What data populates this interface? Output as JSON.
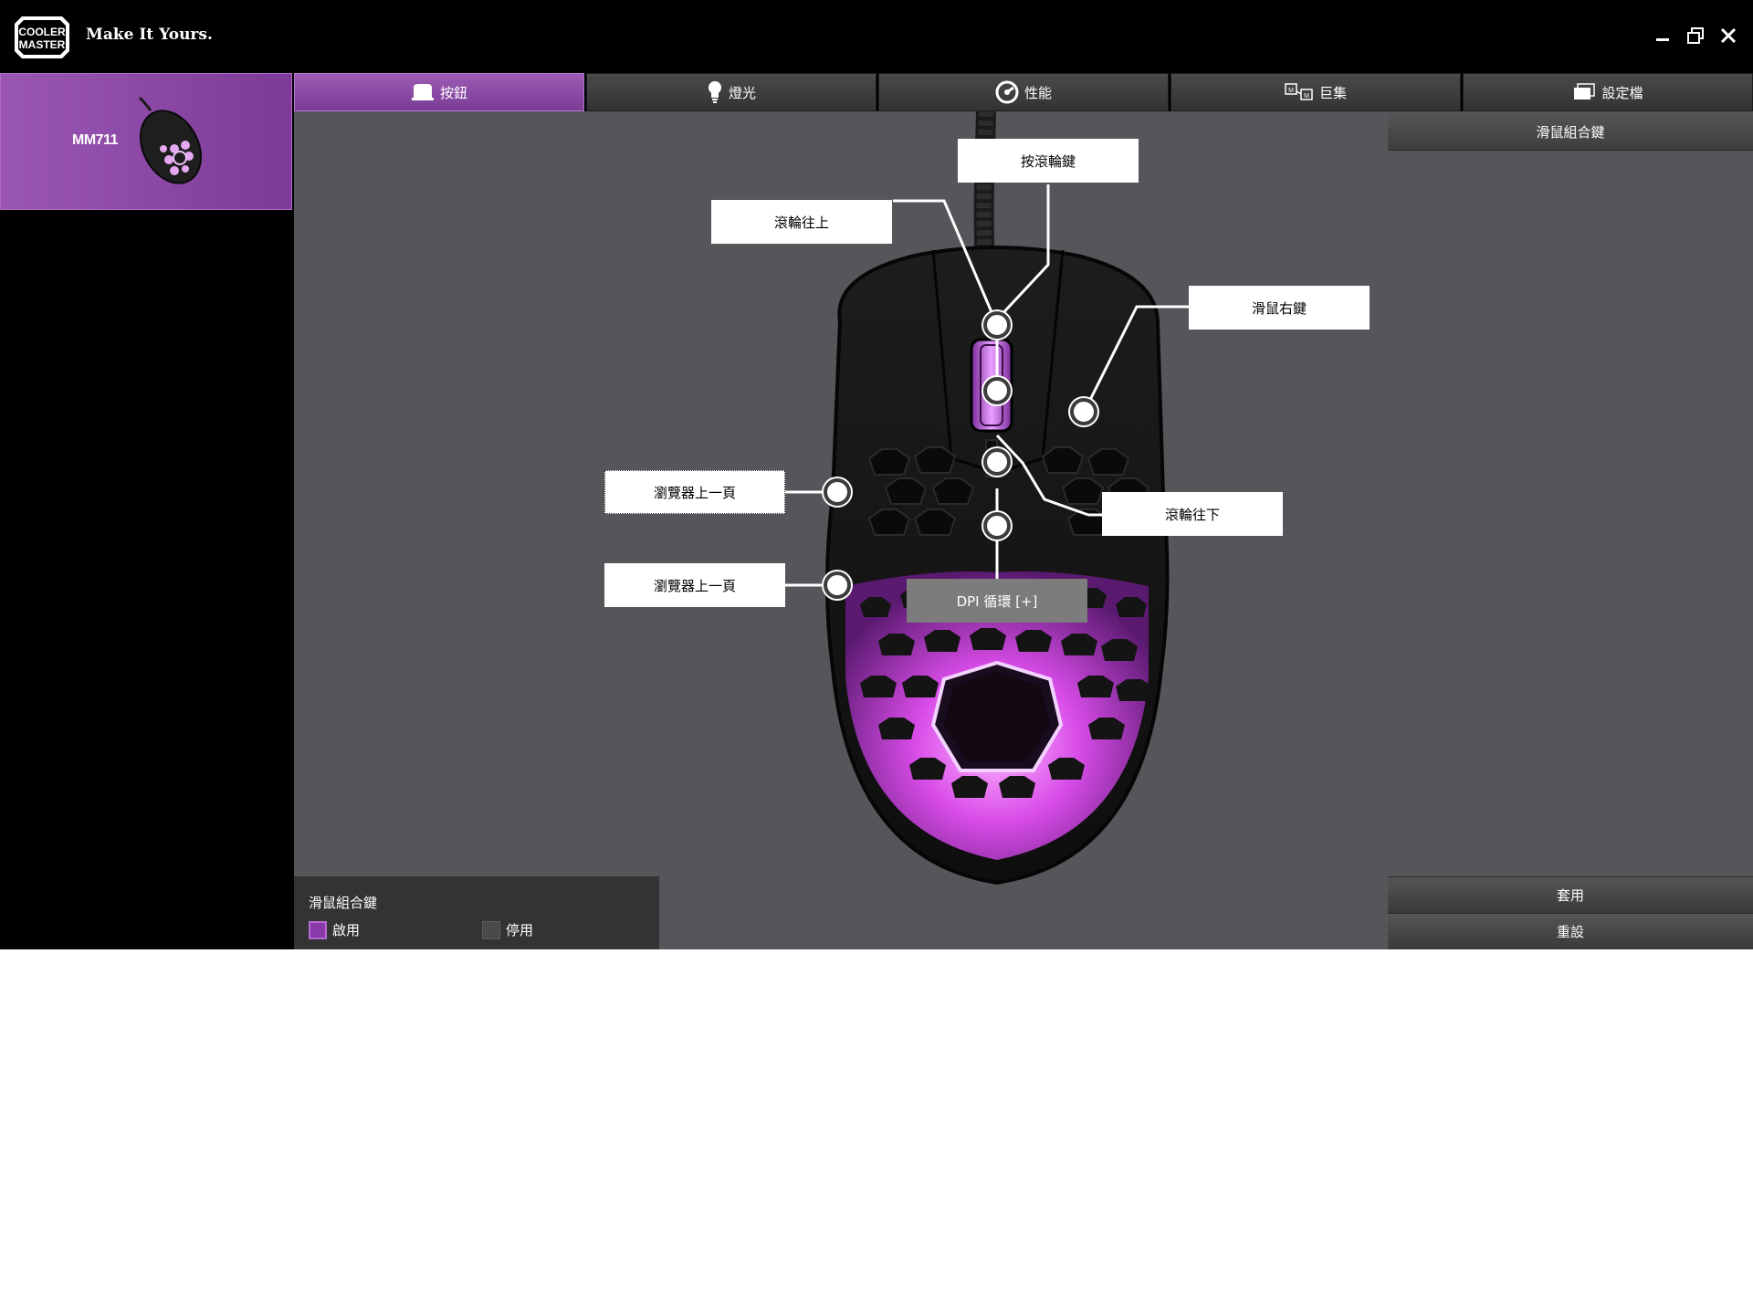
{
  "titlebar": {
    "logo_text": "COOLER MASTER",
    "slogan": "Make It Yours.",
    "window_controls": [
      "minimize-icon",
      "restore-icon",
      "close-icon"
    ]
  },
  "sidebar": {
    "device_name": "MM711"
  },
  "tabs": [
    {
      "label": "按鈕",
      "icon": "mouse-button-icon",
      "active": true
    },
    {
      "label": "燈光",
      "icon": "lightbulb-icon",
      "active": false
    },
    {
      "label": "性能",
      "icon": "performance-icon",
      "active": false
    },
    {
      "label": "巨集",
      "icon": "macro-icon",
      "active": false
    },
    {
      "label": "設定檔",
      "icon": "profile-icon",
      "active": false
    }
  ],
  "diagram": {
    "buttons": {
      "wheel_click": "按滾輪鍵",
      "wheel_up": "滾輪往上",
      "right_button": "滑鼠右鍵",
      "browser_back_1": "瀏覽器上一頁",
      "wheel_down": "滾輪往下",
      "browser_back_2": "瀏覽器上一頁",
      "dpi_cycle": "DPI 循環 [+]"
    }
  },
  "right_panel": {
    "combo_header": "滑鼠組合鍵",
    "apply": "套用",
    "reset": "重設"
  },
  "combo_toggle": {
    "title": "滑鼠組合鍵",
    "enable": "啟用",
    "disable": "停用",
    "selected": "啟用"
  },
  "colors": {
    "accent_purple": "#8a3aa8",
    "canvas_gray": "#55565a",
    "background": "#000000"
  }
}
